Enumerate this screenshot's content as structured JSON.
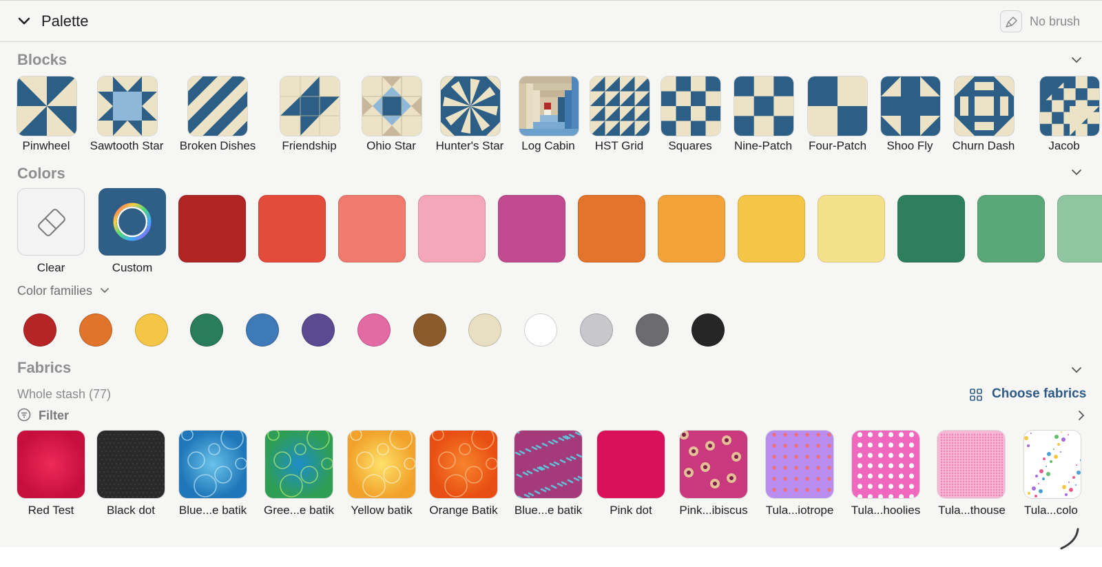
{
  "header": {
    "title": "Palette",
    "brush_label": "No brush"
  },
  "sections": {
    "blocks": "Blocks",
    "colors": "Colors",
    "fabrics": "Fabrics"
  },
  "blocks": [
    {
      "label": "Pinwheel"
    },
    {
      "label": "Sawtooth Star"
    },
    {
      "label": "Broken Dishes"
    },
    {
      "label": "Friendship"
    },
    {
      "label": "Ohio Star"
    },
    {
      "label": "Hunter's Star"
    },
    {
      "label": "Log Cabin"
    },
    {
      "label": "HST Grid"
    },
    {
      "label": "Squares"
    },
    {
      "label": "Nine-Patch"
    },
    {
      "label": "Four-Patch"
    },
    {
      "label": "Shoo Fly"
    },
    {
      "label": "Churn Dash"
    },
    {
      "label": "Jacob"
    }
  ],
  "colors": {
    "clear_label": "Clear",
    "custom_label": "Custom",
    "swatches": [
      "#b02424",
      "#e34b3b",
      "#f07a6e",
      "#f4a7b9",
      "#c24b8f",
      "#e2752a",
      "#f2a33a",
      "#f5c645",
      "#f5e08a",
      "#2e7f5e",
      "#5aa878",
      "#8fc5a0"
    ]
  },
  "color_families": {
    "label": "Color families",
    "colors": [
      "#b62525",
      "#e0742a",
      "#f5c545",
      "#2a7d5a",
      "#3e7ab8",
      "#5b4a92",
      "#e46aa3",
      "#8a5a2b",
      "#e8dfc3",
      "#ffffff",
      "#c7c7cc",
      "#6c6c70",
      "#262626"
    ]
  },
  "fabrics": {
    "subtitle": "Whole stash (77)",
    "choose_label": "Choose fabrics",
    "filter_label": "Filter",
    "items": [
      {
        "label": "Red Test"
      },
      {
        "label": "Black dot"
      },
      {
        "label": "Blue...e batik"
      },
      {
        "label": "Gree...e batik"
      },
      {
        "label": "Yellow batik"
      },
      {
        "label": "Orange Batik"
      },
      {
        "label": "Blue...e batik"
      },
      {
        "label": "Pink dot"
      },
      {
        "label": "Pink...ibiscus"
      },
      {
        "label": "Tula...iotrope"
      },
      {
        "label": "Tula...hoolies"
      },
      {
        "label": "Tula...thouse"
      },
      {
        "label": "Tula...colo"
      }
    ]
  },
  "theme": {
    "navy": "#2d5f86",
    "cream": "#ece2c6",
    "accent": "#2d5b86"
  },
  "icons": [
    "chevron-down-icon",
    "brush-icon",
    "eraser-icon",
    "color-wheel-icon",
    "grid-icon",
    "filter-icon",
    "chevron-right-icon"
  ]
}
